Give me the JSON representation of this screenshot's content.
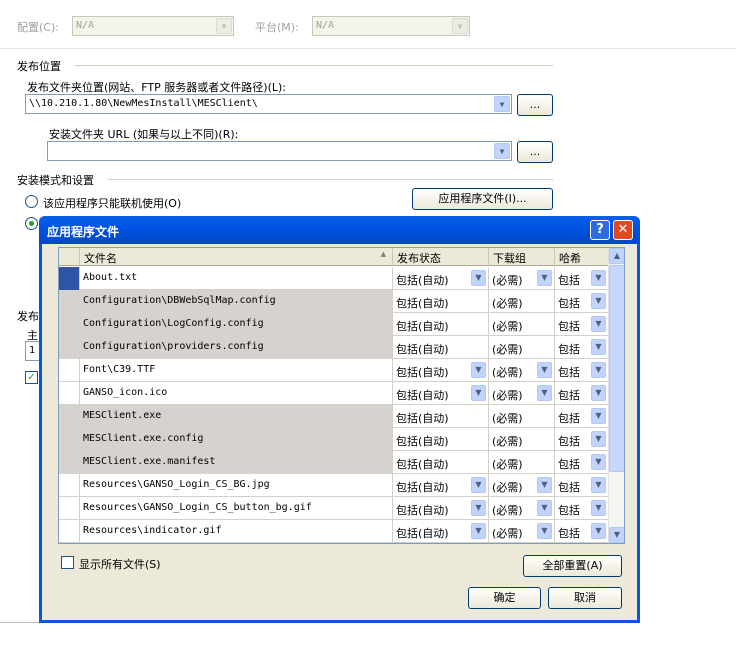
{
  "top": {
    "config_label": "配置(C):",
    "config_value": "N/A",
    "platform_label": "平台(M):",
    "platform_value": "N/A"
  },
  "publish": {
    "section_title": "发布位置",
    "folder_label": "发布文件夹位置(网站、FTP 服务器或者文件路径)(L):",
    "folder_value": "\\\\10.210.1.80\\NewMesInstall\\MESClient\\",
    "browse_label": "...",
    "install_url_label": "安装文件夹 URL (如果与以上不同)(R):",
    "install_url_value": "",
    "browse2_label": "..."
  },
  "install_mode": {
    "section_title": "安装模式和设置",
    "online_only_label": "该应用程序只能联机使用(O)",
    "app_files_button": "应用程序文件(I)...",
    "partial_publish": "发布",
    "partial_main": "主",
    "partial_field": "1"
  },
  "dialog": {
    "title": "应用程序文件",
    "help_button": "?",
    "close_button": "✕",
    "columns": [
      "文件名",
      "发布状态",
      "下载组",
      "哈希"
    ],
    "rows": [
      {
        "file": "About.txt",
        "status": "包括(自动)",
        "group": "(必需)",
        "hash": "包括",
        "editable": true
      },
      {
        "file": "Configuration\\DBWebSqlMap.config",
        "status": "包括(自动)",
        "group": "(必需)",
        "hash": "包括",
        "editable": false
      },
      {
        "file": "Configuration\\LogConfig.config",
        "status": "包括(自动)",
        "group": "(必需)",
        "hash": "包括",
        "editable": false
      },
      {
        "file": "Configuration\\providers.config",
        "status": "包括(自动)",
        "group": "(必需)",
        "hash": "包括",
        "editable": false
      },
      {
        "file": "Font\\C39.TTF",
        "status": "包括(自动)",
        "group": "(必需)",
        "hash": "包括",
        "editable": true
      },
      {
        "file": "GANSO_icon.ico",
        "status": "包括(自动)",
        "group": "(必需)",
        "hash": "包括",
        "editable": true
      },
      {
        "file": "MESClient.exe",
        "status": "包括(自动)",
        "group": "(必需)",
        "hash": "包括",
        "editable": false
      },
      {
        "file": "MESClient.exe.config",
        "status": "包括(自动)",
        "group": "(必需)",
        "hash": "包括",
        "editable": false
      },
      {
        "file": "MESClient.exe.manifest",
        "status": "包括(自动)",
        "group": "(必需)",
        "hash": "包括",
        "editable": false
      },
      {
        "file": "Resources\\GANSO_Login_CS_BG.jpg",
        "status": "包括(自动)",
        "group": "(必需)",
        "hash": "包括",
        "editable": true
      },
      {
        "file": "Resources\\GANSO_Login_CS_button_bg.gif",
        "status": "包括(自动)",
        "group": "(必需)",
        "hash": "包括",
        "editable": true
      },
      {
        "file": "Resources\\indicator.gif",
        "status": "包括(自动)",
        "group": "(必需)",
        "hash": "包括",
        "editable": true
      }
    ],
    "show_all_label": "显示所有文件(S)",
    "reset_all_button": "全部重置(A)",
    "ok_button": "确定",
    "cancel_button": "取消"
  }
}
